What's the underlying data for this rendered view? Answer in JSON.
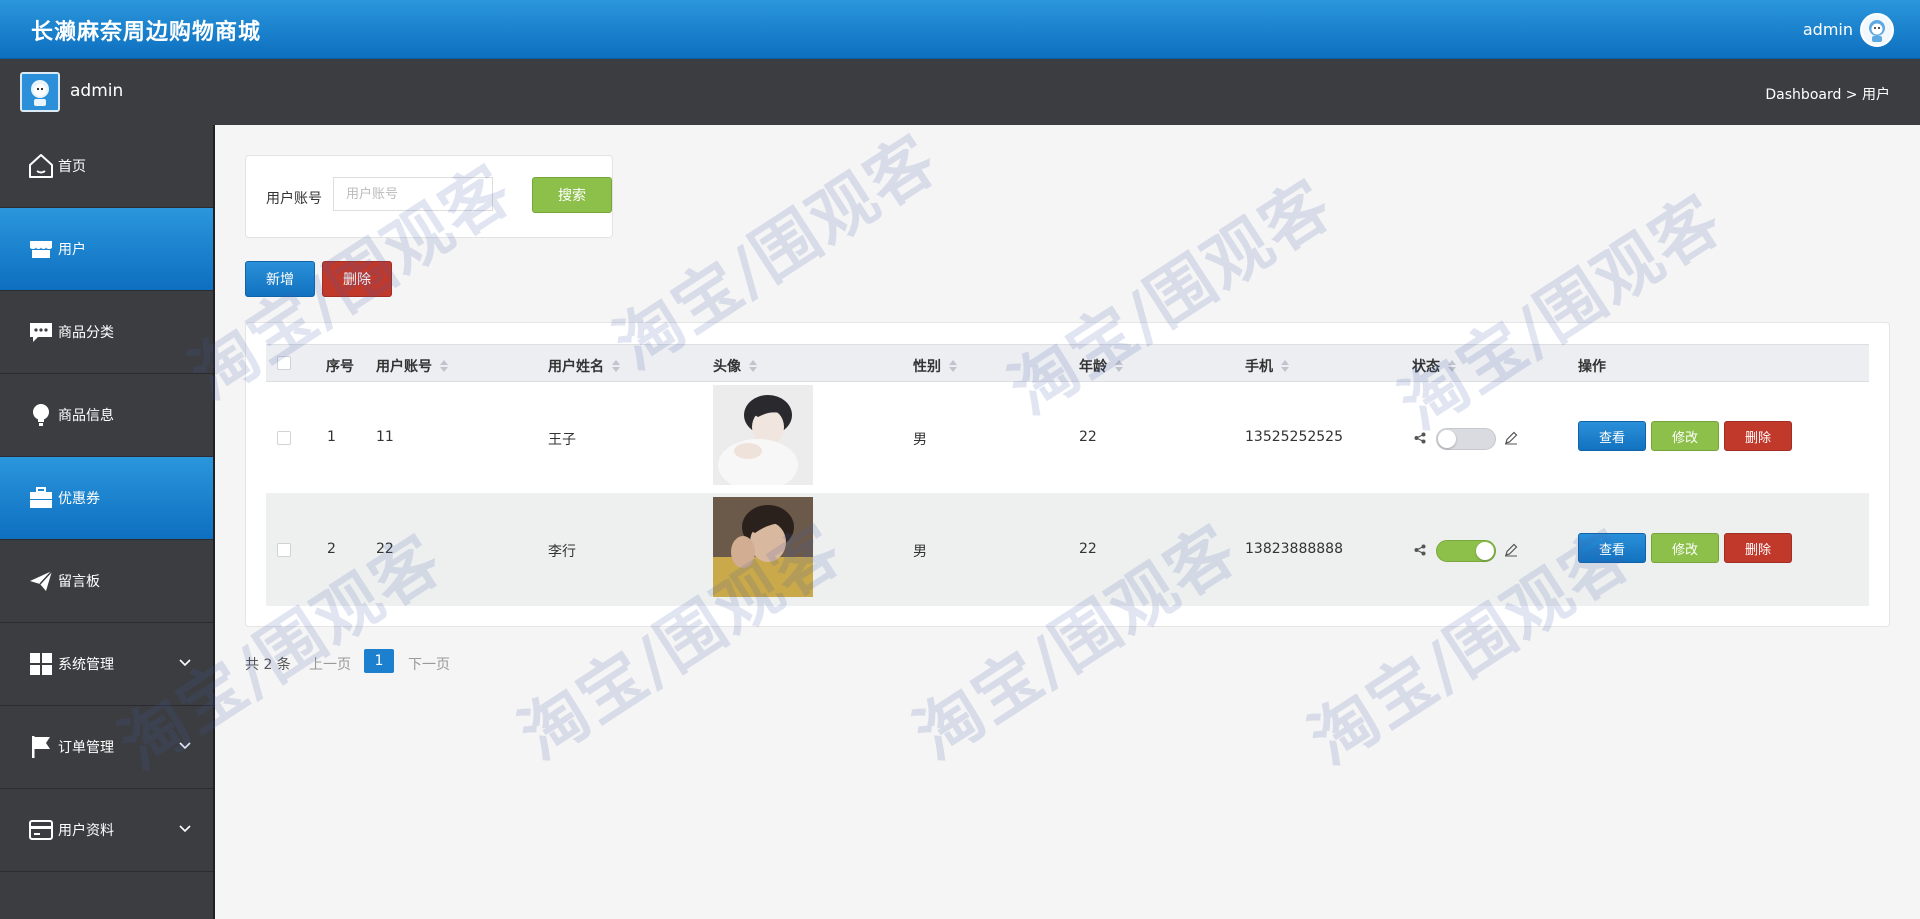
{
  "app": {
    "title": "长濑麻奈周边购物商城",
    "user": "admin"
  },
  "subbar": {
    "name": "admin",
    "breadcrumb": "Dashboard > 用户"
  },
  "sidebar": {
    "items": [
      {
        "label": "首页",
        "icon": "home-icon",
        "active": false
      },
      {
        "label": "用户",
        "icon": "store-icon",
        "active": true
      },
      {
        "label": "商品分类",
        "icon": "chat-icon",
        "active": false
      },
      {
        "label": "商品信息",
        "icon": "bulb-icon",
        "active": false
      },
      {
        "label": "优惠券",
        "icon": "briefcase-icon",
        "active": true
      },
      {
        "label": "留言板",
        "icon": "paper-plane-icon",
        "active": false
      },
      {
        "label": "系统管理",
        "icon": "grid-icon",
        "active": false,
        "expandable": true
      },
      {
        "label": "订单管理",
        "icon": "flag-icon",
        "active": false,
        "expandable": true
      },
      {
        "label": "用户资料",
        "icon": "card-icon",
        "active": false,
        "expandable": true
      }
    ]
  },
  "search": {
    "label": "用户账号",
    "placeholder": "用户账号",
    "value": "",
    "button": "搜索"
  },
  "actions": {
    "add": "新增",
    "delete": "删除"
  },
  "table": {
    "columns": [
      "序号",
      "用户账号",
      "用户姓名",
      "头像",
      "性别",
      "年龄",
      "手机",
      "状态",
      "操作"
    ],
    "rows": [
      {
        "index": "1",
        "account": "11",
        "name": "王子",
        "gender": "男",
        "age": "22",
        "phone": "13525252525",
        "status": false
      },
      {
        "index": "2",
        "account": "22",
        "name": "李行",
        "gender": "男",
        "age": "22",
        "phone": "13823888888",
        "status": true
      }
    ],
    "row_actions": {
      "view": "查看",
      "edit": "修改",
      "delete": "删除"
    }
  },
  "pagination": {
    "total": "共 2 条",
    "prev": "上一页",
    "current": "1",
    "next": "下一页"
  },
  "watermark": "淘宝/围观客",
  "colors": {
    "primary": "#1272c0",
    "success": "#8dc04a",
    "danger": "#c0392b",
    "sidebar": "#3b3d40"
  }
}
